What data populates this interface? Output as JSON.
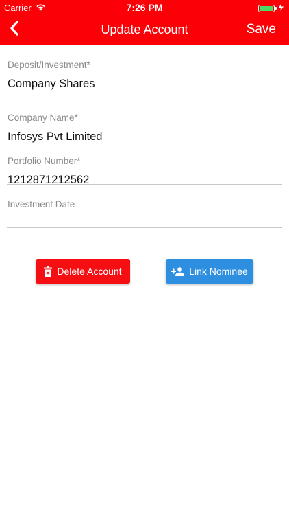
{
  "status": {
    "carrier": "Carrier",
    "time": "7:26 PM",
    "battery_percent": 100
  },
  "nav": {
    "title": "Update Account",
    "save_label": "Save",
    "back_icon": "chevron-left-icon"
  },
  "form": {
    "fields": [
      {
        "label": "Deposit/Investment*",
        "value": "Company Shares"
      },
      {
        "label": "Company Name*",
        "value": "Infosys Pvt Limited"
      },
      {
        "label": "Portfolio Number*",
        "value": "1212871212562"
      },
      {
        "label": "Investment Date",
        "value": ""
      }
    ]
  },
  "actions": {
    "delete_label": "Delete Account",
    "link_label": "Link Nominee"
  },
  "colors": {
    "header": "#fb0007",
    "delete": "#f50e12",
    "link": "#2e8fe0"
  }
}
